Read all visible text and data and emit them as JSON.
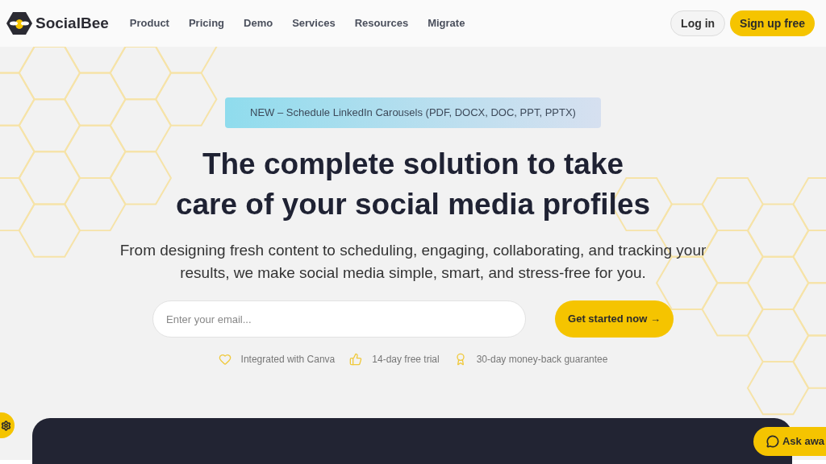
{
  "nav": {
    "brand": "SocialBee",
    "links": [
      "Product",
      "Pricing",
      "Demo",
      "Services",
      "Resources",
      "Migrate"
    ],
    "login": "Log in",
    "signup": "Sign up free"
  },
  "hero": {
    "banner": "NEW – Schedule LinkedIn Carousels (PDF, DOCX, DOC, PPT, PPTX)",
    "title_lines": [
      "The complete solution to take",
      "care of your social media profiles"
    ],
    "subtitle": "From designing fresh content to scheduling, engaging, collaborating, and tracking your results, we make social media simple, smart, and stress-free for you.",
    "email_placeholder": "Enter your email...",
    "cta": "Get started now →",
    "features": [
      {
        "kind": "heart",
        "text": "Integrated with Canva"
      },
      {
        "kind": "thumb",
        "text": "14-day free trial"
      },
      {
        "kind": "award",
        "text": "30-day money-back guarantee"
      }
    ]
  },
  "chat_button": "Ask awa"
}
